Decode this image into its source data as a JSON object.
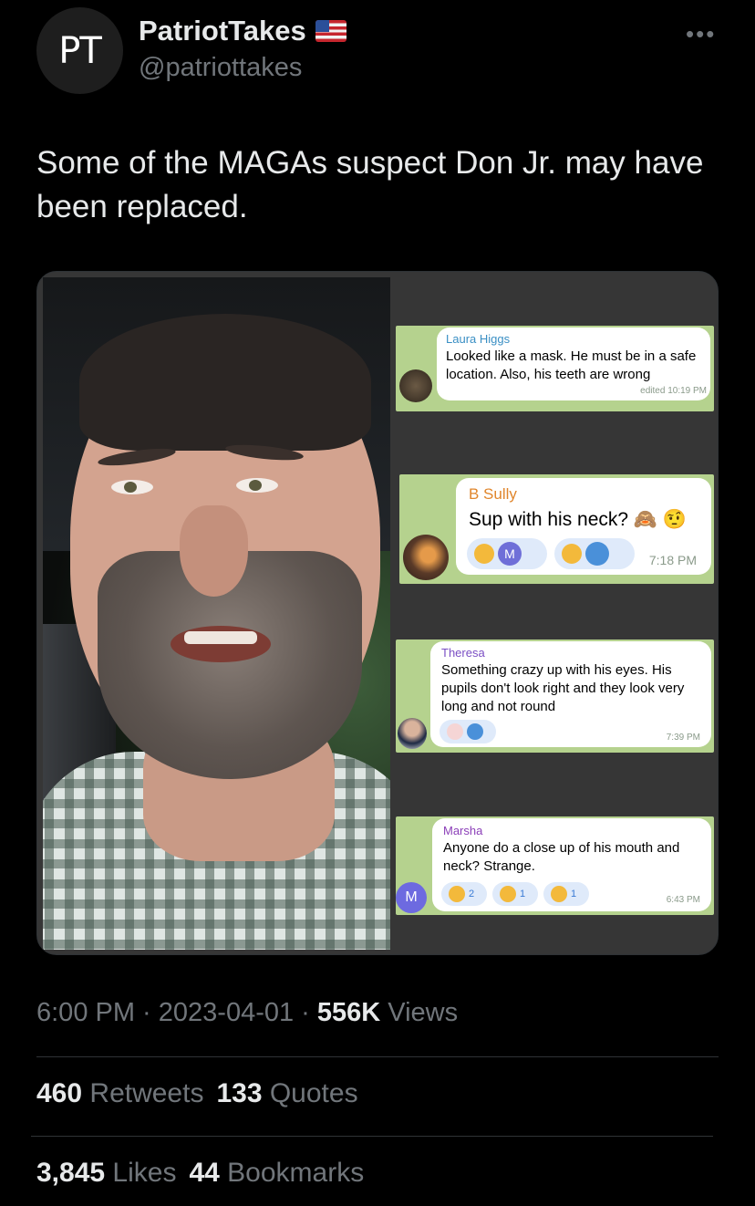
{
  "author": {
    "avatar_text": "PT",
    "display_name": "PatriotTakes",
    "flag_icon": "us-flag-icon",
    "handle": "@patriottakes",
    "more_label": "•••"
  },
  "tweet": {
    "text": "Some of the MAGAs suspect Don Jr. may have been replaced."
  },
  "media": {
    "chats": [
      {
        "sender": "Laura Higgs",
        "text_line1": "Looked like a mask. He must be in a safe",
        "text_line2": "location.  Also, his teeth are  wrong",
        "time": "edited 10:19 PM"
      },
      {
        "sender": "B Sully",
        "text": "Sup with his neck? 🙈 🤨",
        "reaction1_avatar": "M",
        "time": "7:18 PM"
      },
      {
        "sender": "Theresa",
        "text_line1": "Something crazy up with his eyes. His",
        "text_line2": "pupils don't look right and they look very",
        "text_line3": "long and not round",
        "time": "7:39 PM"
      },
      {
        "sender": "Marsha",
        "text_line1": "Anyone do a close up of his mouth and",
        "text_line2": "neck? Strange.",
        "reaction1_count": "2",
        "reaction2_count": "1",
        "reaction3_count": "1",
        "avatar_letter": "M",
        "time": "6:43 PM"
      }
    ]
  },
  "meta": {
    "time": "6:00 PM",
    "sep1": " · ",
    "date": "2023-04-01",
    "sep2": " · ",
    "views_count": "556K",
    "views_label": " Views"
  },
  "stats": {
    "retweets_count": "460",
    "retweets_label": " Retweets",
    "quotes_count": "133",
    "quotes_label": " Quotes",
    "likes_count": "3,845",
    "likes_label": " Likes",
    "bookmarks_count": "44",
    "bookmarks_label": " Bookmarks"
  },
  "colors": {
    "background": "#000000",
    "text": "#e7e9ea",
    "muted": "#71767b",
    "chat_bg": "#b5d28e"
  }
}
